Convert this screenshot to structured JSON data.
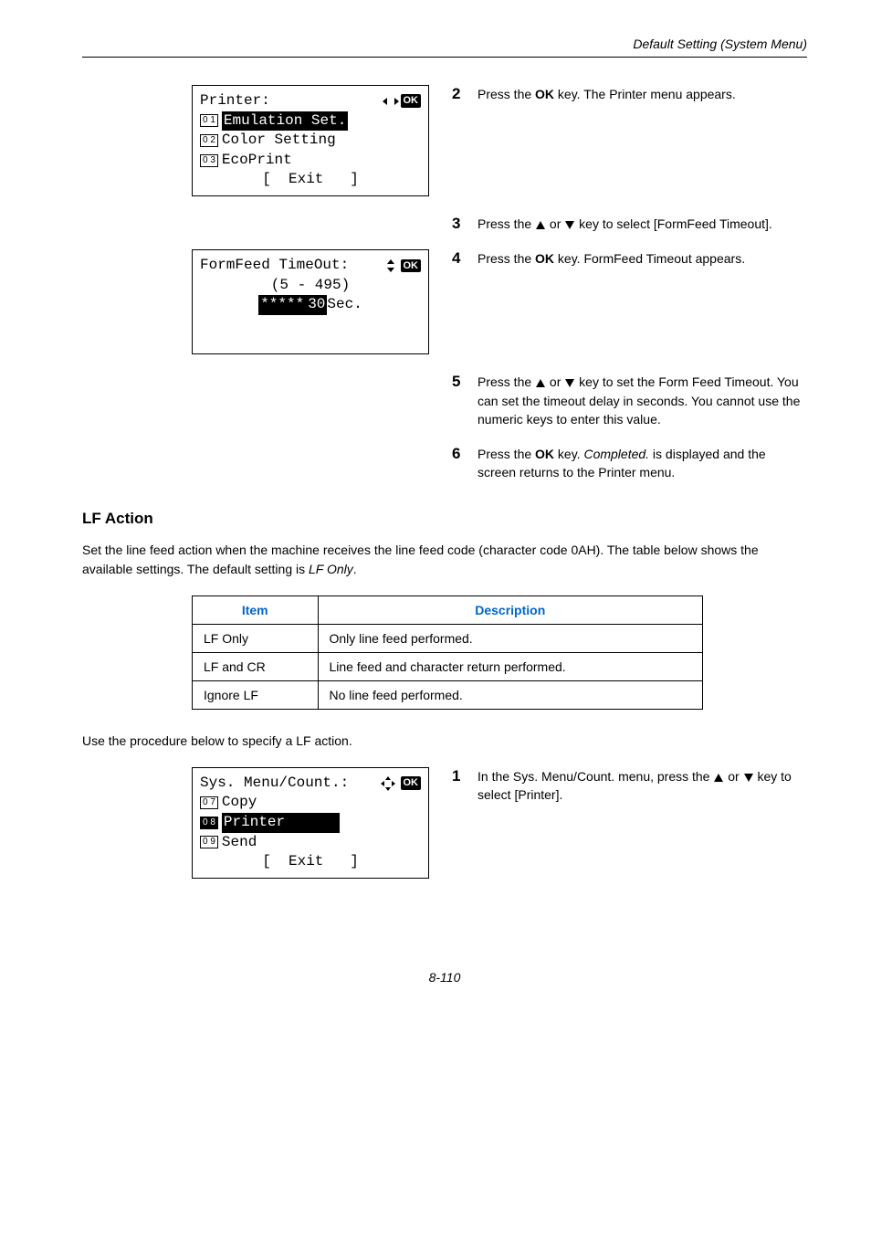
{
  "header": "Default Setting (System Menu)",
  "lcd1": {
    "title": "Printer:",
    "line1": "Emulation Set.",
    "line2": "Color Setting",
    "line3": "EcoPrint",
    "footer": "[  Exit   ]",
    "n1": "0 1",
    "n2": "0 2",
    "n3": "0 3"
  },
  "lcd2": {
    "title": "FormFeed TimeOut:",
    "range": "(5 - 495)",
    "valPrefix": "*****",
    "valNum": "30",
    "valSuffix": "Sec."
  },
  "lcd3": {
    "title": "Sys. Menu/Count.:",
    "line1": "Copy",
    "line2": "Printer",
    "line3": "Send",
    "footer": "[  Exit   ]",
    "n1": "0 7",
    "n2": "0 8",
    "n3": "0 9"
  },
  "steps": {
    "s2": "Press the OK key. The Printer menu appears.",
    "s3a": "Press the ",
    "s3b": " or ",
    "s3c": " key to select [FormFeed Timeout].",
    "s4": "Press the OK key. FormFeed Timeout appears.",
    "s5a": "Press the ",
    "s5b": " or ",
    "s5c": " key to set the Form Feed Timeout. You can set the timeout delay in seconds. You cannot use the numeric keys to enter this value.",
    "s6a": "Press the ",
    "s6b": "OK",
    "s6c": " key. ",
    "s6d": "Completed.",
    "s6e": " is displayed and the screen returns to the Printer menu.",
    "s1a": "In the Sys. Menu/Count. menu, press the ",
    "s1b": " or ",
    "s1c": " key to select [Printer]."
  },
  "section": "LF Action",
  "sectionText": "Set the line feed action when the machine receives the line feed code (character code 0AH). The table below shows the available settings. The default setting is LF Only.",
  "table": {
    "h1": "Item",
    "h2": "Description",
    "rows": [
      [
        "LF Only",
        "Only line feed performed."
      ],
      [
        "LF and CR",
        "Line feed and character return performed."
      ],
      [
        "Ignore LF",
        "No line feed performed."
      ]
    ]
  },
  "procedureText": "Use the procedure below to specify a LF action.",
  "pageNum": "8-110",
  "ok": "OK"
}
